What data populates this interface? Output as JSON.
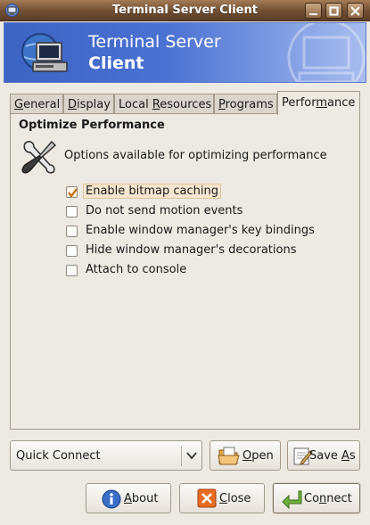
{
  "window": {
    "title": "Terminal Server Client"
  },
  "banner": {
    "line1": "Terminal Server",
    "line2": "Client"
  },
  "tabs": [
    {
      "label_pre": "",
      "mnemonic": "G",
      "label_post": "eneral"
    },
    {
      "label_pre": "",
      "mnemonic": "D",
      "label_post": "isplay"
    },
    {
      "label_pre": "Local ",
      "mnemonic": "R",
      "label_post": "esources"
    },
    {
      "label_pre": "",
      "mnemonic": "P",
      "label_post": "rograms"
    },
    {
      "label_pre": "Perfor",
      "mnemonic": "m",
      "label_post": "ance"
    }
  ],
  "performance": {
    "section_title": "Optimize Performance",
    "description": "Options available for optimizing performance",
    "options": [
      {
        "label": "Enable bitmap caching",
        "checked": true
      },
      {
        "label": "Do not send motion events",
        "checked": false
      },
      {
        "label": "Enable window manager's key bindings",
        "checked": false
      },
      {
        "label": "Hide window manager's decorations",
        "checked": false
      },
      {
        "label": "Attach to console",
        "checked": false
      }
    ]
  },
  "quick_connect": {
    "value": "Quick Connect"
  },
  "buttons": {
    "open": {
      "mnemonic": "O",
      "rest": "pen"
    },
    "save_as": {
      "pre": "Save ",
      "mnemonic": "A",
      "rest": "s"
    },
    "about": {
      "mnemonic": "A",
      "rest": "bout"
    },
    "close": {
      "mnemonic": "C",
      "rest": "lose"
    },
    "connect": {
      "pre": "Co",
      "mnemonic": "n",
      "rest": "nect"
    }
  },
  "colors": {
    "titlebar": "#6f4e32",
    "banner": "#4a72d2",
    "hover": "#f6e6cf",
    "check": "#c06a10"
  }
}
